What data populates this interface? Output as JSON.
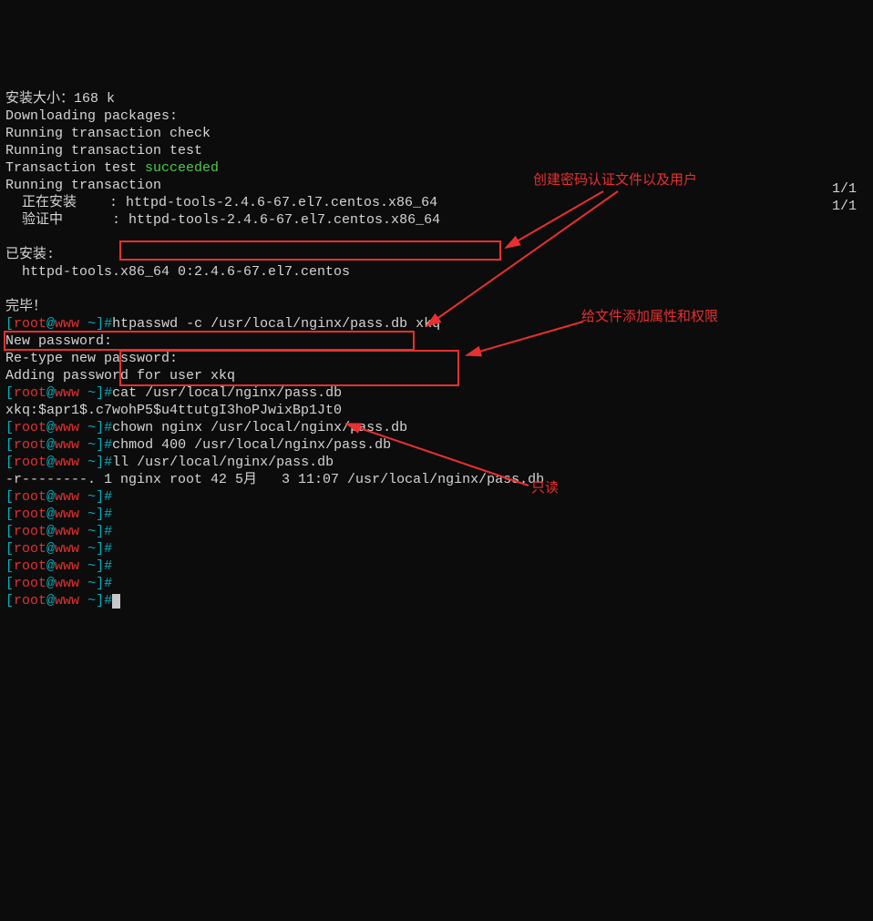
{
  "lines": {
    "l0": "安装大小：168 k",
    "l1": "Downloading packages:",
    "l2": "Running transaction check",
    "l3": "Running transaction test",
    "l4a": "Transaction test ",
    "l4b": "succeeded",
    "l5": "Running transaction",
    "l6a": "  正在安装    : httpd-tools-2.4.6-67.el7.centos.x86_64",
    "l6b": "1/1",
    "l7a": "  验证中      : httpd-tools-2.4.6-67.el7.centos.x86_64",
    "l7b": "1/1",
    "l8": "已安装:",
    "l9": "  httpd-tools.x86_64 0:2.4.6-67.el7.centos",
    "l10": "完毕！",
    "cmd1": "htpasswd -c /usr/local/nginx/pass.db xkq",
    "l12": "New password:",
    "l13": "Re-type new password:",
    "l14": "Adding password for user xkq",
    "cmd2": "cat /usr/local/nginx/pass.db",
    "l16": "xkq:$apr1$.c7wohP5$u4ttutgI3hoPJwixBp1Jt0",
    "cmd3": "chown nginx /usr/local/nginx/pass.db",
    "cmd4": "chmod 400 /usr/local/nginx/pass.db",
    "cmd5": "ll /usr/local/nginx/pass.db",
    "l20": "-r--------. 1 nginx root 42 5月   3 11:07 /usr/local/nginx/pass.db"
  },
  "prompt": {
    "open": "[",
    "user": "root",
    "at": "@",
    "host": "www",
    "path": " ~",
    "close": "]",
    "hash": "#"
  },
  "annotations": {
    "a1": "创建密码认证文件以及用户",
    "a2": "给文件添加属性和权限",
    "a3": "只读"
  }
}
